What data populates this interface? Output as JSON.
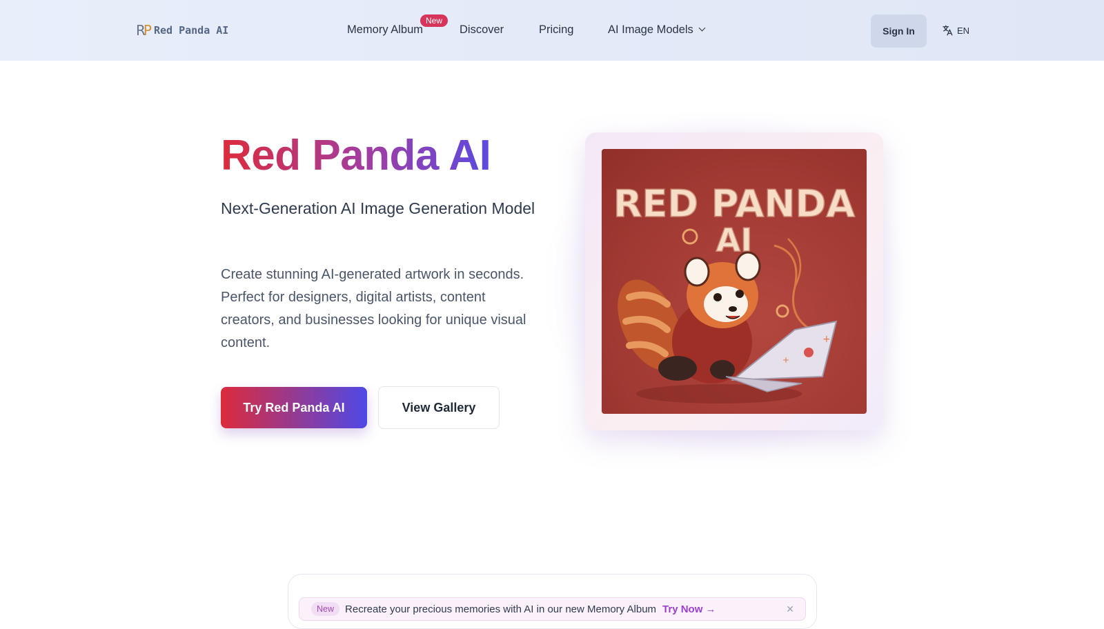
{
  "header": {
    "logo_mark_r": "R",
    "logo_mark_p": "P",
    "logo_text": "Red Panda AI",
    "nav": [
      {
        "label": "Memory Album"
      },
      {
        "label": "Discover"
      },
      {
        "label": "Pricing"
      },
      {
        "label": "AI Image Models"
      }
    ],
    "new_badge": "New",
    "signin_label": "Sign In",
    "lang_icon": "translate-icon",
    "lang_label": "EN"
  },
  "hero": {
    "title": "Red Panda AI",
    "subtitle": "Next-Generation AI Image Generation Model",
    "description": "Create stunning AI-generated artwork in seconds. Perfect for designers, digital artists, content creators, and businesses looking for unique visual content.",
    "primary_button": "Try Red Panda AI",
    "secondary_button": "View Gallery",
    "image_text_line1": "RED PANDA",
    "image_text_line2": "AI"
  },
  "banner": {
    "badge": "New",
    "text": "Recreate your precious memories with AI in our new Memory Album",
    "link": "Try Now →",
    "close_icon": "close-icon"
  },
  "colors": {
    "accent_red": "#dc2b3b",
    "accent_indigo": "#4f49e6",
    "badge_pink": "#d6345b",
    "link_purple": "#9b3ed1"
  }
}
